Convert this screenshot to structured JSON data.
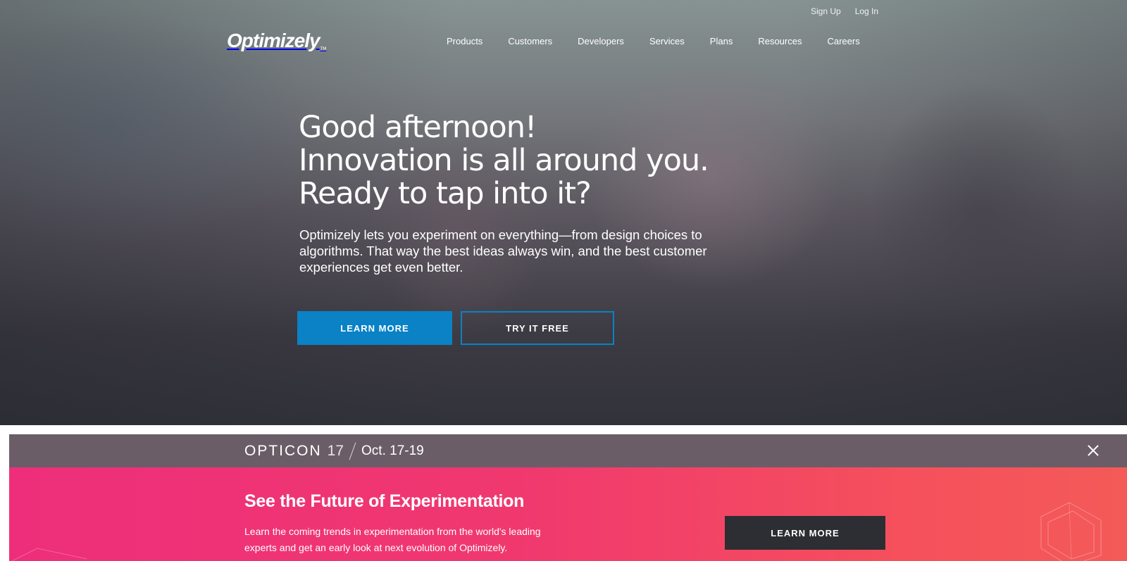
{
  "utility_nav": {
    "sign_up": "Sign Up",
    "log_in": "Log In"
  },
  "brand": {
    "logo_text": "Optimizely",
    "trademark": "TM"
  },
  "main_nav": {
    "items": [
      "Products",
      "Customers",
      "Developers",
      "Services",
      "Plans",
      "Resources",
      "Careers"
    ]
  },
  "hero": {
    "headline_lines": [
      "Good afternoon!",
      "Innovation is all around you.",
      "Ready to tap into it?"
    ],
    "subtext": "Optimizely lets you experiment on everything—from design choices to algorithms. That way the best ideas always win, and the best customer experiences get even better.",
    "primary_button": "LEARN MORE",
    "secondary_button": "TRY IT FREE",
    "primary_color": "#0a82c5"
  },
  "promo": {
    "event_name": "OPTICON",
    "event_year": "17",
    "event_date": "Oct. 17-19",
    "close_icon": "close-icon",
    "title": "See the Future of Experimentation",
    "text": "Learn the coming trends in experimentation from the world's leading experts and get an early look at next evolution of Optimizely.",
    "button": "LEARN MORE",
    "gradient_start": "#ee2e7b",
    "gradient_end": "#f45a58",
    "bar_color": "#6b5d68"
  }
}
